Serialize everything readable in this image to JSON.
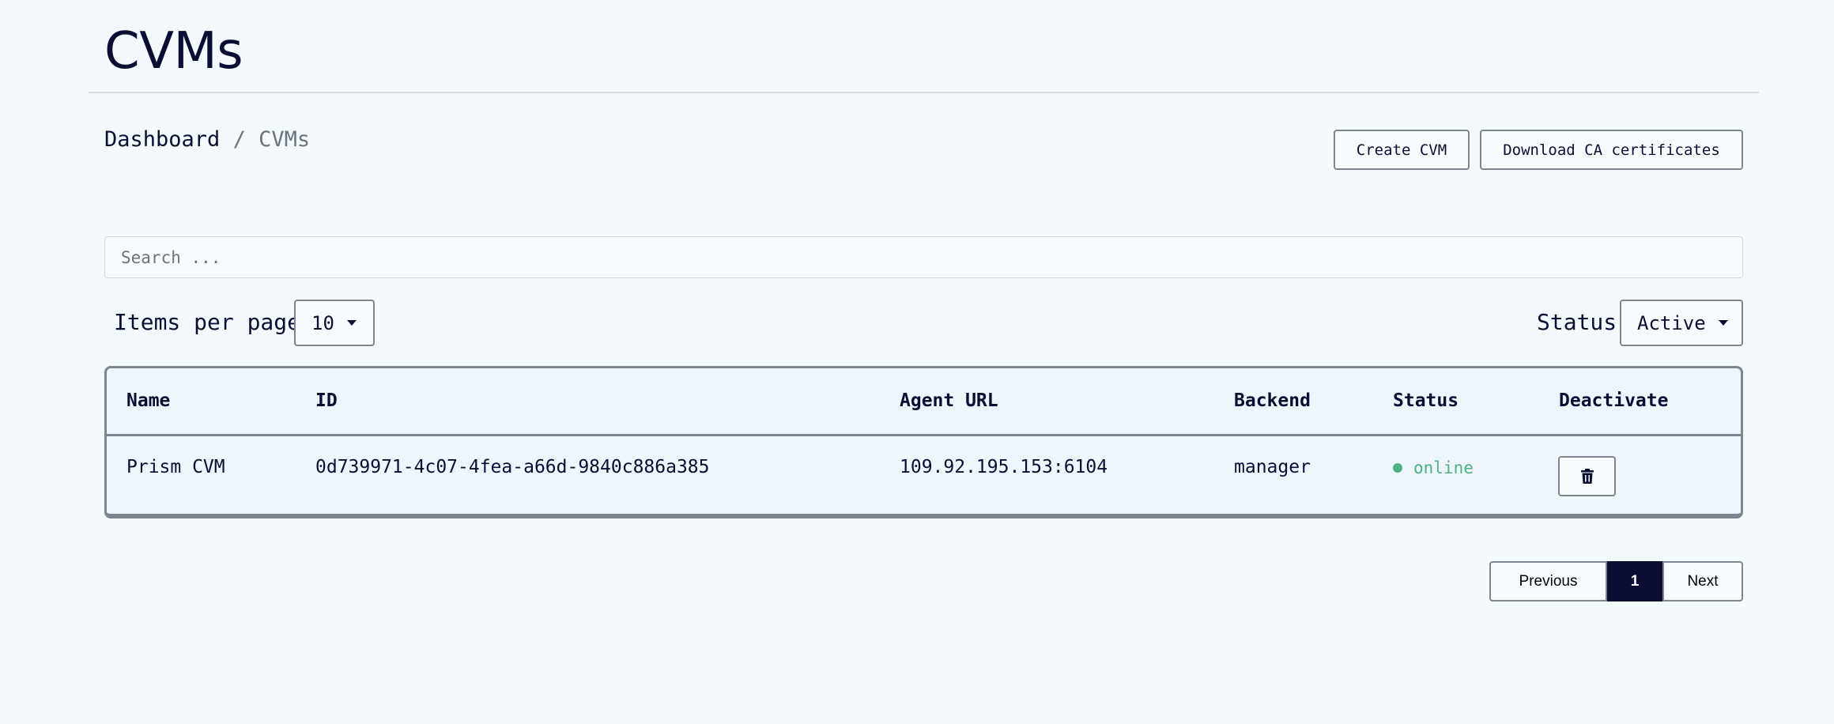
{
  "page": {
    "title": "CVMs"
  },
  "breadcrumb": {
    "root": "Dashboard",
    "separator": "/",
    "current": "CVMs"
  },
  "actions": {
    "create_label": "Create CVM",
    "download_label": "Download CA certificates"
  },
  "search": {
    "placeholder": "Search ...",
    "value": ""
  },
  "filters": {
    "items_per_page_label": "Items per page",
    "items_per_page_value": "10",
    "status_label": "Status",
    "status_value": "Active"
  },
  "table": {
    "columns": [
      "Name",
      "ID",
      "Agent URL",
      "Backend",
      "Status",
      "Deactivate"
    ],
    "rows": [
      {
        "name": "Prism CVM",
        "id": "0d739971-4c07-4fea-a66d-9840c886a385",
        "agent_url": "109.92.195.153:6104",
        "backend": "manager",
        "status": "online",
        "deactivate_icon": "trash-icon"
      }
    ]
  },
  "pagination": {
    "previous_label": "Previous",
    "current_page": "1",
    "next_label": "Next"
  },
  "colors": {
    "background": "#f4f9fd",
    "text": "#0b0e33",
    "border": "#7d8590",
    "online": "#4cb281",
    "active_page": "#0b0e33"
  }
}
